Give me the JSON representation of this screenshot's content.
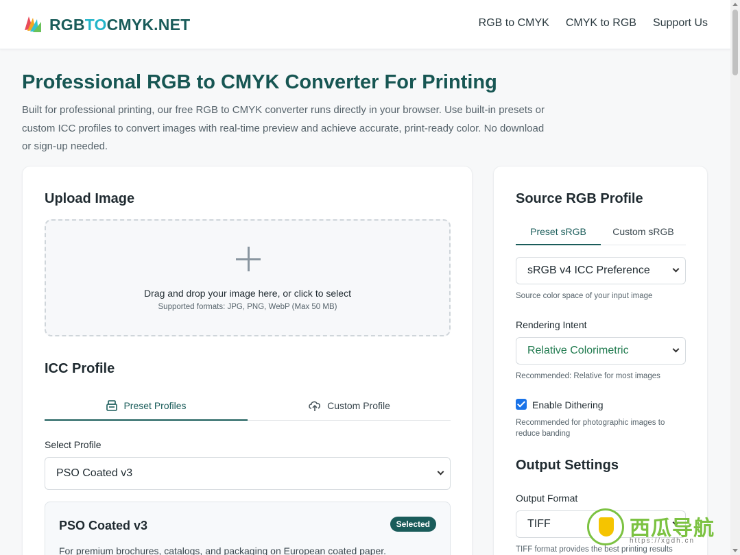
{
  "header": {
    "logo_part1": "RGB",
    "logo_part2": "TO",
    "logo_part3": "CMYK.NET",
    "nav": [
      "RGB to CMYK",
      "CMYK to RGB",
      "Support Us"
    ]
  },
  "intro": {
    "title": "Professional RGB to CMYK Converter For Printing",
    "lead": "Built for professional printing, our free RGB to CMYK converter runs directly in your browser. Use built-in presets or custom ICC profiles to convert images with real-time preview and achieve accurate, print-ready color. No download or sign-up needed."
  },
  "upload": {
    "heading": "Upload Image",
    "drop_text": "Drag and drop your image here, or click to select",
    "formats": "Supported formats: JPG, PNG, WebP (Max 50 MB)"
  },
  "icc": {
    "heading": "ICC Profile",
    "tabs": [
      {
        "label": "Preset Profiles",
        "icon": "printer-icon"
      },
      {
        "label": "Custom Profile",
        "icon": "cloud-upload-icon"
      }
    ],
    "select_label": "Select Profile",
    "selected_profile": "PSO Coated v3",
    "card_title": "PSO Coated v3",
    "badge": "Selected",
    "card_desc": "For premium brochures, catalogs, and packaging on European coated paper."
  },
  "source": {
    "heading": "Source RGB Profile",
    "tabs": [
      "Preset sRGB",
      "Custom sRGB"
    ],
    "profile_value": "sRGB v4 ICC Preference",
    "profile_helper": "Source color space of your input image",
    "intent_label": "Rendering Intent",
    "intent_value": "Relative Colorimetric",
    "intent_helper": "Recommended: Relative for most images",
    "dither_label": "Enable Dithering",
    "dither_checked": true,
    "dither_helper": "Recommended for photographic images to reduce banding"
  },
  "output": {
    "heading": "Output Settings",
    "format_label": "Output Format",
    "format_value": "TIFF",
    "format_helper": "TIFF format provides the best printing results"
  },
  "watermark": {
    "text": "西瓜导航",
    "url": "https://xgdh.cn"
  },
  "colors": {
    "brand_dark": "#1a5c5a",
    "brand_light": "#23b5c9",
    "title": "#175653",
    "checkbox": "#1a73e8"
  }
}
